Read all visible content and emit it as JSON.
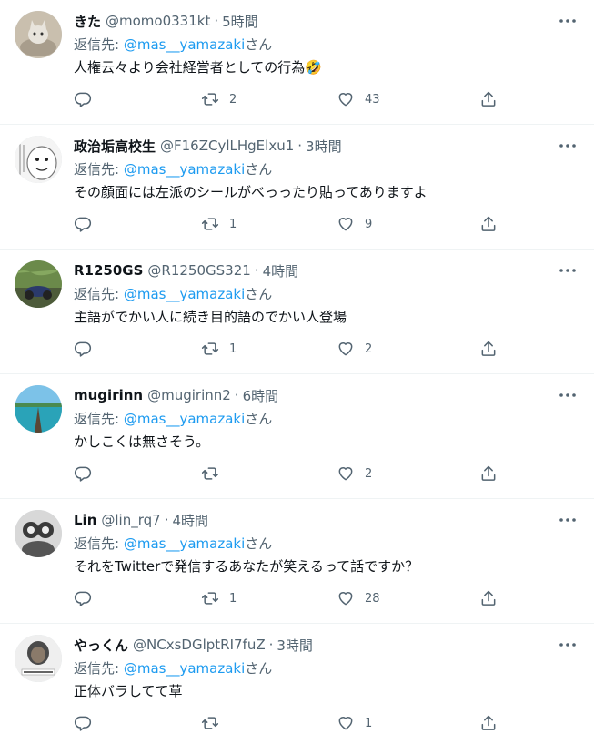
{
  "colors": {
    "accent": "#1d9bf0",
    "muted": "#536471",
    "text": "#0f1419",
    "divider": "#eff3f4"
  },
  "icons": {
    "reply": "reply-icon",
    "retweet": "retweet-icon",
    "like": "heart-icon",
    "share": "share-icon",
    "more": "more-icon"
  },
  "tweets": [
    {
      "name": "きた",
      "handle": "@momo0331kt",
      "time": "5時間",
      "reply_label": "返信先: ",
      "reply_to": "@mas__yamazaki",
      "reply_suffix": "さん",
      "text": "人権云々より会社経営者としての行為🤣",
      "replies": "",
      "retweets": "2",
      "likes": "43"
    },
    {
      "name": "政治垢高校生",
      "handle": "@F16ZCylLHgElxu1",
      "time": "3時間",
      "reply_label": "返信先: ",
      "reply_to": "@mas__yamazaki",
      "reply_suffix": "さん",
      "text": "その顔面には左派のシールがべっったり貼ってありますよ",
      "replies": "",
      "retweets": "1",
      "likes": "9"
    },
    {
      "name": "R1250GS",
      "handle": "@R1250GS321",
      "time": "4時間",
      "reply_label": "返信先: ",
      "reply_to": "@mas__yamazaki",
      "reply_suffix": "さん",
      "text": "主語がでかい人に続き目的語のでかい人登場",
      "replies": "",
      "retweets": "1",
      "likes": "2"
    },
    {
      "name": "mugirinn",
      "handle": "@mugirinn2",
      "time": "6時間",
      "reply_label": "返信先: ",
      "reply_to": "@mas__yamazaki",
      "reply_suffix": "さん",
      "text": "かしこくは無さそう。",
      "replies": "",
      "retweets": "",
      "likes": "2"
    },
    {
      "name": "Lin",
      "handle": "@lin_rq7",
      "time": "4時間",
      "reply_label": "返信先: ",
      "reply_to": "@mas__yamazaki",
      "reply_suffix": "さん",
      "text": "それをTwitterで発信するあなたが笑えるって話ですか？",
      "replies": "",
      "retweets": "1",
      "likes": "28"
    },
    {
      "name": "やっくん",
      "handle": "@NCxsDGlptRI7fuZ",
      "time": "3時間",
      "reply_label": "返信先: ",
      "reply_to": "@mas__yamazaki",
      "reply_suffix": "さん",
      "text": "正体バラしてて草",
      "replies": "",
      "retweets": "",
      "likes": "1"
    }
  ]
}
